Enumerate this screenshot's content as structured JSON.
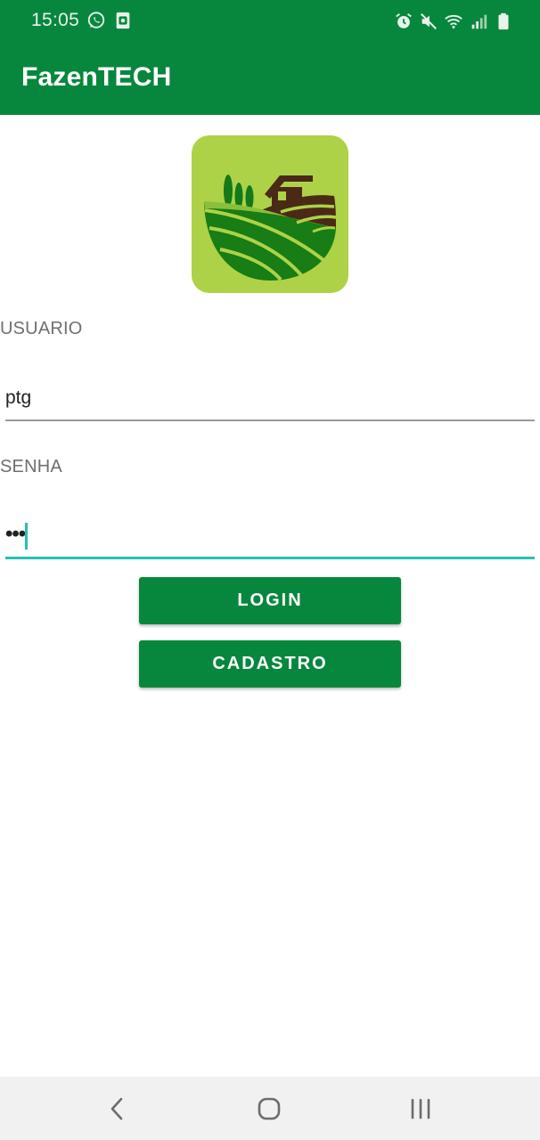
{
  "status_bar": {
    "time": "15:05",
    "left_icons": [
      "whatsapp-icon",
      "screenshot-icon"
    ],
    "right_icons": [
      "alarm-icon",
      "mute-icon",
      "wifi-icon",
      "signal-icon",
      "battery-icon"
    ]
  },
  "app_bar": {
    "title": "FazenTECH",
    "color": "#07873d"
  },
  "logo": {
    "icon": "farm-logo-icon",
    "background": "#add247"
  },
  "form": {
    "user_label": "USUARIO",
    "user_value": "ptg",
    "password_label": "SENHA",
    "password_value": "•••",
    "focused_field": "password",
    "accent_color": "#26c1b7"
  },
  "buttons": {
    "login_label": "LOGIN",
    "register_label": "CADASTRO"
  },
  "nav_bar": {
    "icons": [
      "back-icon",
      "home-icon",
      "recent-apps-icon"
    ]
  }
}
